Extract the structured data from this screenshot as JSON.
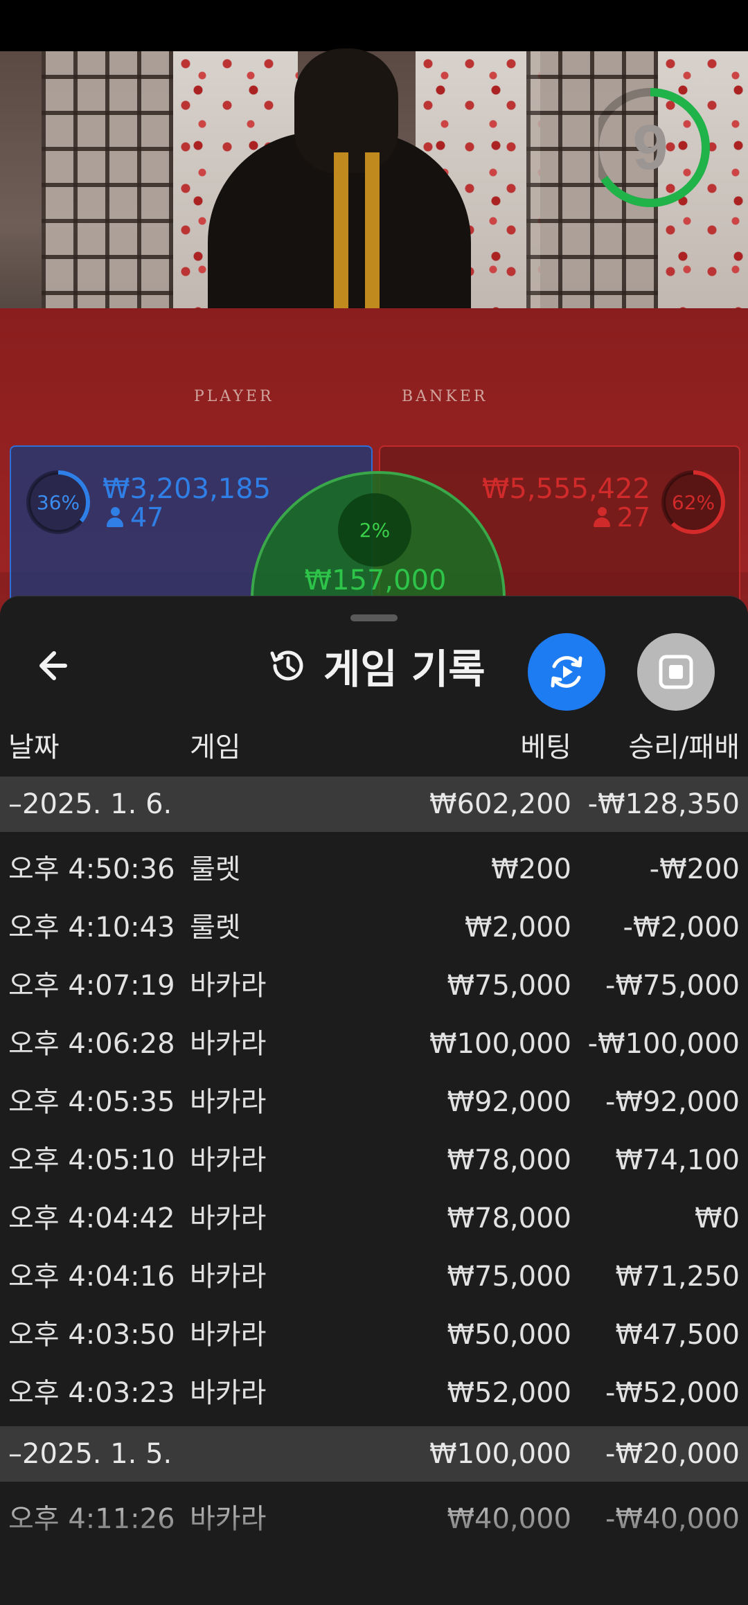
{
  "video": {
    "countdown": "9",
    "felt_labels": [
      "PLAYER",
      "BANKER"
    ],
    "player": {
      "percent": "36%",
      "amount": "₩3,203,185",
      "count": "47"
    },
    "banker": {
      "percent": "62%",
      "amount": "₩5,555,422",
      "count": "27"
    },
    "tie": {
      "percent": "2%",
      "amount": "₩157,000"
    }
  },
  "sheet": {
    "title": "게임 기록",
    "columns": {
      "date": "날짜",
      "game": "게임",
      "bet": "베팅",
      "winloss": "승리/패배"
    },
    "groups": [
      {
        "date": "–2025. 1. 6.",
        "bet_total": "₩602,200",
        "winloss_total": "-₩128,350",
        "rows": [
          {
            "time": "오후 4:50:36",
            "game": "룰렛",
            "bet": "₩200",
            "winloss": "-₩200"
          },
          {
            "time": "오후 4:10:43",
            "game": "룰렛",
            "bet": "₩2,000",
            "winloss": "-₩2,000"
          },
          {
            "time": "오후 4:07:19",
            "game": "바카라",
            "bet": "₩75,000",
            "winloss": "-₩75,000"
          },
          {
            "time": "오후 4:06:28",
            "game": "바카라",
            "bet": "₩100,000",
            "winloss": "-₩100,000"
          },
          {
            "time": "오후 4:05:35",
            "game": "바카라",
            "bet": "₩92,000",
            "winloss": "-₩92,000"
          },
          {
            "time": "오후 4:05:10",
            "game": "바카라",
            "bet": "₩78,000",
            "winloss": "₩74,100"
          },
          {
            "time": "오후 4:04:42",
            "game": "바카라",
            "bet": "₩78,000",
            "winloss": "₩0"
          },
          {
            "time": "오후 4:04:16",
            "game": "바카라",
            "bet": "₩75,000",
            "winloss": "₩71,250"
          },
          {
            "time": "오후 4:03:50",
            "game": "바카라",
            "bet": "₩50,000",
            "winloss": "₩47,500"
          },
          {
            "time": "오후 4:03:23",
            "game": "바카라",
            "bet": "₩52,000",
            "winloss": "-₩52,000"
          }
        ]
      },
      {
        "date": "–2025. 1. 5.",
        "bet_total": "₩100,000",
        "winloss_total": "-₩20,000",
        "rows": [
          {
            "time": "오후 4:11:26",
            "game": "바카라",
            "bet": "₩40,000",
            "winloss": "-₩40,000"
          }
        ]
      }
    ]
  },
  "icons": {
    "back": "arrow-left-icon",
    "history": "history-clock-icon",
    "replay": "replay-video-icon",
    "stop": "stop-square-icon"
  },
  "colors": {
    "player_blue": "#2e6fd8",
    "banker_red": "#c12a2a",
    "tie_green": "#3aa84a",
    "replay_button": "#1e7cf2",
    "countdown_ring": "#1fb34a"
  }
}
